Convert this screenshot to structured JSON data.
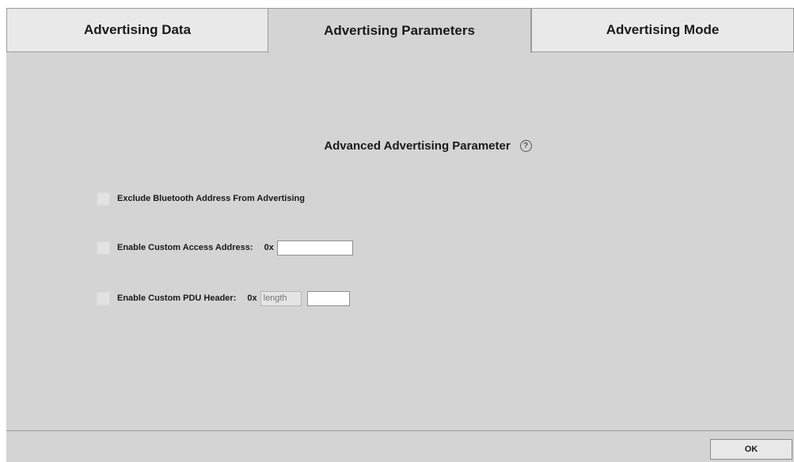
{
  "tabs": [
    {
      "label": "Advertising Data",
      "active": false
    },
    {
      "label": "Advertising Parameters",
      "active": true
    },
    {
      "label": "Advertising Mode",
      "active": false
    }
  ],
  "section": {
    "title": "Advanced Advertising Parameter",
    "help_icon": "question-circle-icon"
  },
  "options": {
    "exclude_address": {
      "label": "Exclude Bluetooth Address From Advertising",
      "checked": false
    },
    "custom_access_address": {
      "label": "Enable Custom Access Address:",
      "prefix": "0x",
      "value": "",
      "checked": false
    },
    "custom_pdu_header": {
      "label": "Enable Custom PDU Header:",
      "prefix": "0x",
      "length_placeholder": "length",
      "value": "",
      "checked": false
    }
  },
  "footer": {
    "ok_label": "OK"
  },
  "colors": {
    "background": "#d4d4d4",
    "tab_inactive": "#e9e9e9",
    "border": "#9a9a9a"
  }
}
